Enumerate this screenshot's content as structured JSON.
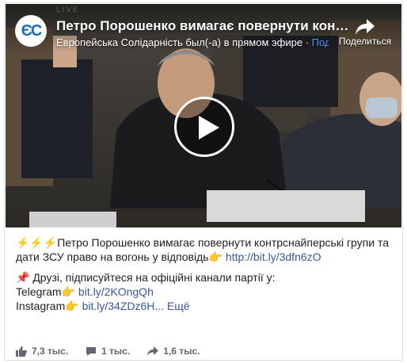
{
  "video": {
    "watermark": "LIVE",
    "logo_text": "ЄС",
    "title": "Петро Порошенко вимагає повернути контрснайперські групи та дати ЗСУ право на вогонь у відповідь",
    "page_name": "Европейська Солідарність был(-а) в прямом эфире",
    "separator": " · ",
    "follow": "Подпи",
    "share_label": "Поделиться",
    "icons": [
      "share-arrow-icon",
      "play-icon"
    ]
  },
  "post": {
    "line1_emoji": "⚡⚡⚡",
    "line1_text": "Петро Порошенко вимагає повернути контрснайперські групи та дати ЗСУ право на вогонь у відповідь",
    "line1_hand": "👉",
    "line1_link": "http://bit.ly/3dfn6zO",
    "line2_pin": "📌",
    "line2_text": "Друзі, підписуйтеся на офіційні канали партії у:",
    "telegram_label": "Telegram",
    "telegram_hand": "👉",
    "telegram_link": "bit.ly/2KOngQh",
    "instagram_label": "Instagram",
    "instagram_hand": "👉",
    "instagram_link": "bit.ly/34ZDz6H...",
    "more": "Ещё"
  },
  "stats": {
    "likes": "7,3 тыс.",
    "comments": "1 тыс.",
    "shares": "1,6 тыс.",
    "icons": [
      "thumbs-up-icon",
      "comment-icon",
      "share-icon"
    ]
  }
}
